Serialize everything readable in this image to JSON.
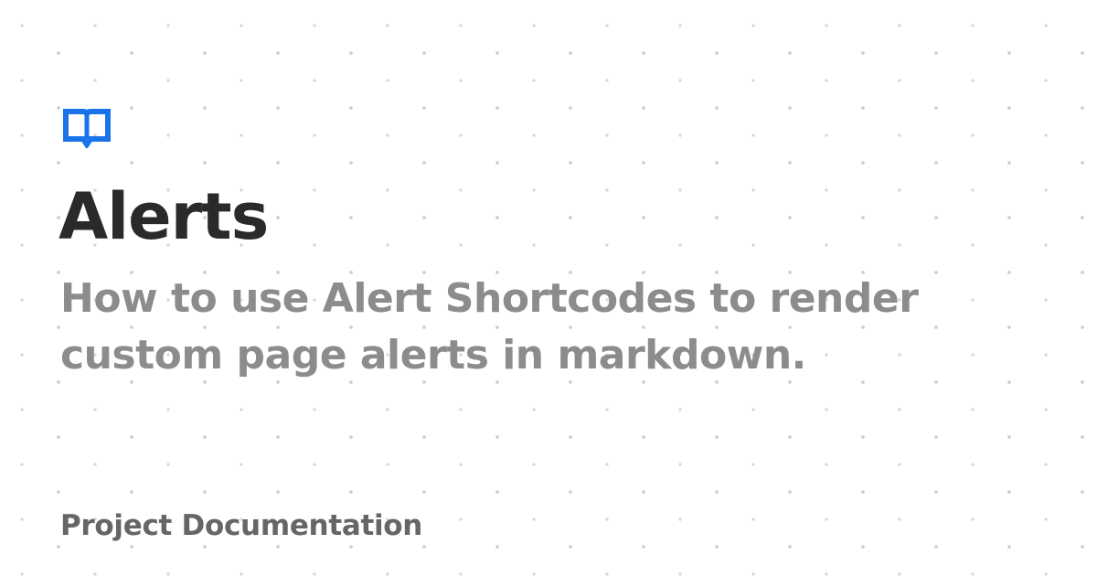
{
  "logo": {
    "icon": "open-book-icon",
    "color": "#1a73e8"
  },
  "page": {
    "title": "Alerts",
    "description": "How to use Alert Shortcodes to render custom page alerts in markdown.",
    "site_name": "Project Documentation"
  },
  "colors": {
    "background": "#ffffff",
    "title": "#2a2a2a",
    "description": "#8c8c8c",
    "site_name": "#666666",
    "dot_pattern": "#d0d0d0"
  }
}
